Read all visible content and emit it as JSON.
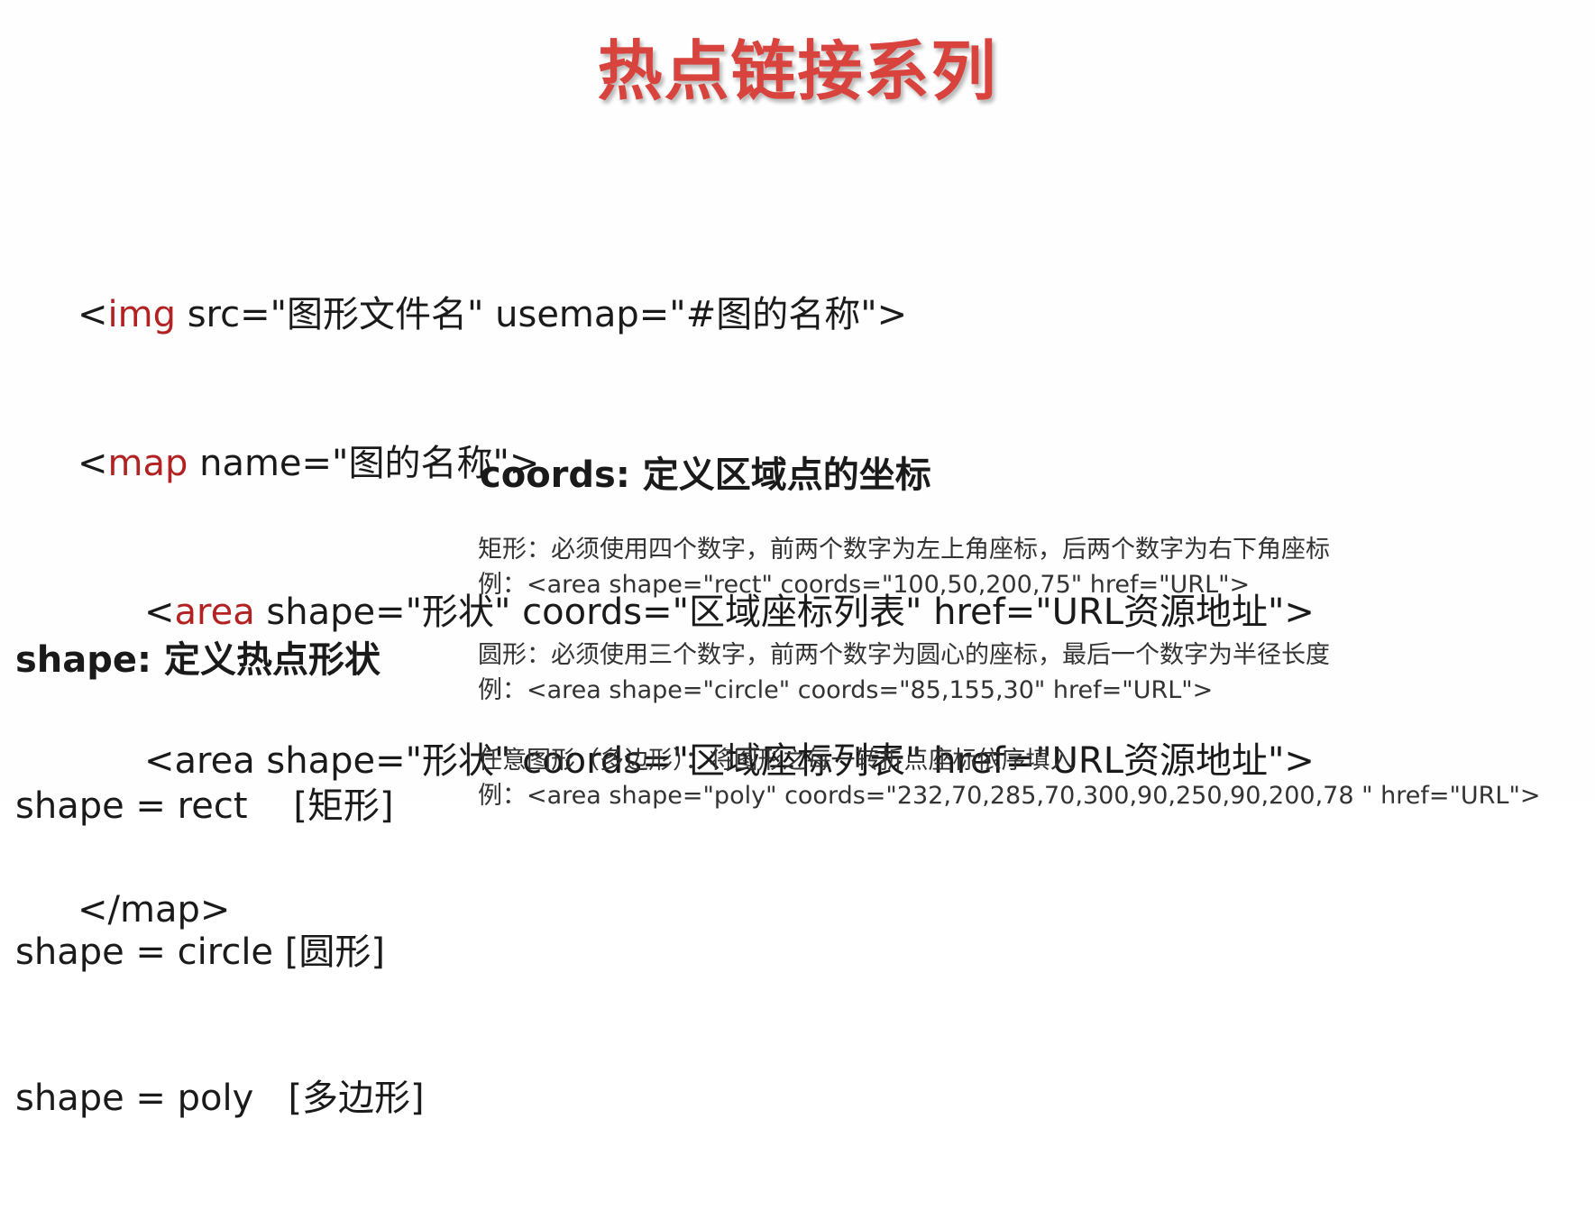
{
  "title": "热点链接系列",
  "code": {
    "line1": {
      "open": "<",
      "tag": "img",
      "rest": " src=\"图形文件名\" usemap=\"#图的名称\">"
    },
    "line2": {
      "open": "<",
      "tag": "map",
      "rest": " name=\"图的名称\">"
    },
    "line3": {
      "open": "<",
      "tag": "area",
      "rest": " shape=\"形状\" coords=\"区域座标列表\" href=\"URL资源地址\">"
    },
    "line4": "<area shape=\"形状\" coords=\"区域座标列表\" href=\"URL资源地址\">",
    "line5": "</map>"
  },
  "coords_heading": "coords: 定义区域点的坐标",
  "shape_section": {
    "heading": "shape: 定义热点形状",
    "items": [
      "shape = rect    [矩形]",
      "shape = circle [圆形]",
      "shape = poly   [多边形]"
    ]
  },
  "descriptions": [
    {
      "text": "矩形：必须使用四个数字，前两个数字为左上角座标，后两个数字为右下角座标",
      "example": "例：<area shape=\"rect\" coords=\"100,50,200,75\" href=\"URL\">"
    },
    {
      "text": "圆形：必须使用三个数字，前两个数字为圆心的座标，最后一个数字为半径长度",
      "example": "例：<area shape=\"circle\" coords=\"85,155,30\" href=\"URL\">"
    },
    {
      "text": "任意图形（多边形）：将图形之每一转折点座标依序填入",
      "example": "例：<area shape=\"poly\" coords=\"232,70,285,70,300,90,250,90,200,78 \" href=\"URL\">"
    }
  ],
  "colors": {
    "title": "#d9433d",
    "keyword": "#b22222",
    "text": "#1a1a1a",
    "description": "#333333"
  }
}
